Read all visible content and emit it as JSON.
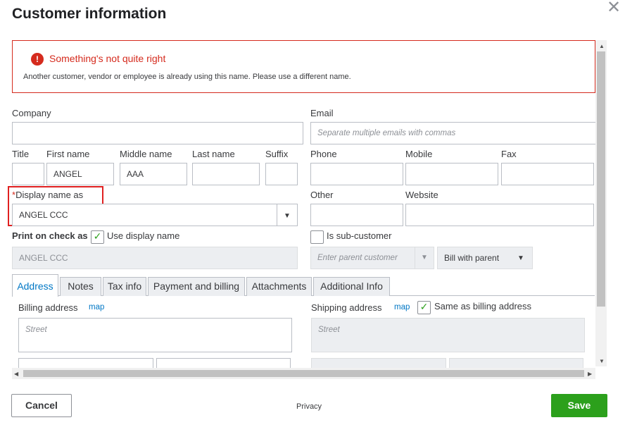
{
  "dialog": {
    "title": "Customer information",
    "close_glyph": "✕"
  },
  "error": {
    "icon": "!",
    "title": "Something's not quite right",
    "message": "Another customer, vendor or employee is already using this name. Please use a different name."
  },
  "fields": {
    "company_label": "Company",
    "company_value": "",
    "email_label": "Email",
    "email_placeholder": "Separate multiple emails with commas",
    "title_label": "Title",
    "title_value": "",
    "first_label": "First name",
    "first_value": "ANGEL",
    "middle_label": "Middle name",
    "middle_value": "AAA",
    "last_label": "Last name",
    "last_value": "",
    "suffix_label": "Suffix",
    "suffix_value": "",
    "phone_label": "Phone",
    "phone_value": "",
    "mobile_label": "Mobile",
    "mobile_value": "",
    "fax_label": "Fax",
    "fax_value": "",
    "display_req": "*",
    "display_label": "Display name as",
    "display_value": "ANGEL CCC",
    "other_label": "Other",
    "other_value": "",
    "website_label": "Website",
    "website_value": "",
    "print_label": "Print on check as",
    "use_display_label": "Use display name",
    "use_display_checked": "✓",
    "print_value": "ANGEL CCC",
    "subcustomer_label": "Is sub-customer",
    "parent_placeholder": "Enter parent customer",
    "bill_value": "Bill with parent"
  },
  "tabs": [
    "Address",
    "Notes",
    "Tax info",
    "Payment and billing",
    "Attachments",
    "Additional Info"
  ],
  "address": {
    "billing_label": "Billing address",
    "billing_map": "map",
    "street_placeholder": "Street",
    "shipping_label": "Shipping address",
    "shipping_map": "map",
    "same_label": "Same as billing address",
    "same_checked": "✓",
    "shipping_street_placeholder": "Street"
  },
  "footer": {
    "cancel": "Cancel",
    "privacy": "Privacy",
    "save": "Save"
  },
  "glyphs": {
    "caret": "▼",
    "up": "▲",
    "down": "▼",
    "left": "◀",
    "right": "▶"
  }
}
